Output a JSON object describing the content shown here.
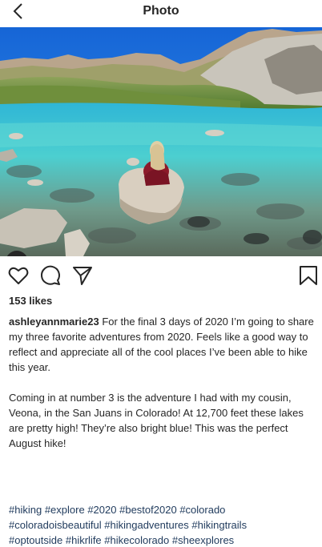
{
  "header": {
    "title": "Photo",
    "back_icon": "chevron-left-icon"
  },
  "photo": {
    "description_icons": [
      "user-tag-icon"
    ]
  },
  "actions": {
    "icons": [
      "heart-icon",
      "comment-icon",
      "share-icon",
      "bookmark-icon"
    ]
  },
  "post": {
    "likes": "153 likes",
    "username": "ashleyannmarie23",
    "caption_p1": "For the final 3 days of 2020 I’m going to share my three favorite adventures from 2020. Feels like a good way to reflect and appreciate all of the cool places I’ve been able to hike this year.",
    "caption_p2": "Coming in at number 3 is the adventure I had with my cousin, Veona, in the San Juans in Colorado! At 12,700 feet these lakes are pretty high! They’re also bright blue! This was the perfect August hike!",
    "hashtags": [
      "#hiking",
      "#explore",
      "#2020",
      "#bestof2020",
      "#colorado",
      "#coloradoisbeautiful",
      "#hikingadventures",
      "#hikingtrails",
      "#optoutside",
      "#hikrlife",
      "#hikecolorado",
      "#sheexplores"
    ]
  },
  "colors": {
    "text": "#262626",
    "hashtag": "#1f3a5c",
    "sky": "#1e7fe0",
    "lake": "#3ec6c9"
  }
}
